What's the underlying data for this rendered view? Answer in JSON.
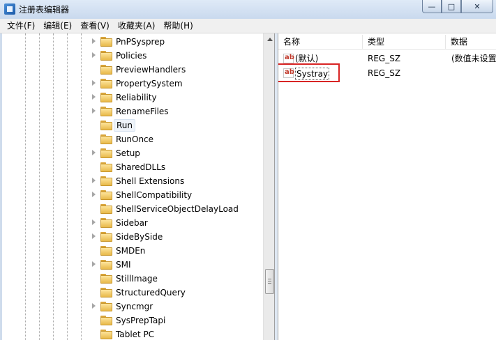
{
  "window": {
    "title": "注册表编辑器",
    "buttons": [
      "—",
      "□",
      "✕"
    ]
  },
  "menu": [
    "文件(F)",
    "编辑(E)",
    "查看(V)",
    "收藏夹(A)",
    "帮助(H)"
  ],
  "tree": [
    {
      "label": "PnPSysprep",
      "expandable": true
    },
    {
      "label": "Policies",
      "expandable": true
    },
    {
      "label": "PreviewHandlers",
      "expandable": false
    },
    {
      "label": "PropertySystem",
      "expandable": true
    },
    {
      "label": "Reliability",
      "expandable": true
    },
    {
      "label": "RenameFiles",
      "expandable": true
    },
    {
      "label": "Run",
      "expandable": false,
      "selected": true
    },
    {
      "label": "RunOnce",
      "expandable": false
    },
    {
      "label": "Setup",
      "expandable": true
    },
    {
      "label": "SharedDLLs",
      "expandable": false
    },
    {
      "label": "Shell Extensions",
      "expandable": true
    },
    {
      "label": "ShellCompatibility",
      "expandable": true
    },
    {
      "label": "ShellServiceObjectDelayLoad",
      "expandable": false
    },
    {
      "label": "Sidebar",
      "expandable": true
    },
    {
      "label": "SideBySide",
      "expandable": true
    },
    {
      "label": "SMDEn",
      "expandable": false
    },
    {
      "label": "SMI",
      "expandable": true
    },
    {
      "label": "StillImage",
      "expandable": false
    },
    {
      "label": "StructuredQuery",
      "expandable": false
    },
    {
      "label": "Syncmgr",
      "expandable": true
    },
    {
      "label": "SysPrepTapi",
      "expandable": false
    },
    {
      "label": "Tablet PC",
      "expandable": false
    }
  ],
  "list": {
    "columns": [
      "名称",
      "类型",
      "数据"
    ],
    "rows": [
      {
        "name": "(默认)",
        "type": "REG_SZ",
        "data": "(数值未设置",
        "icon": "ab"
      },
      {
        "name": "Systray",
        "type": "REG_SZ",
        "data": "",
        "icon": "ab",
        "highlighted": true
      }
    ]
  },
  "colors": {
    "highlight": "#d82424",
    "folder": "#f0c75a"
  }
}
